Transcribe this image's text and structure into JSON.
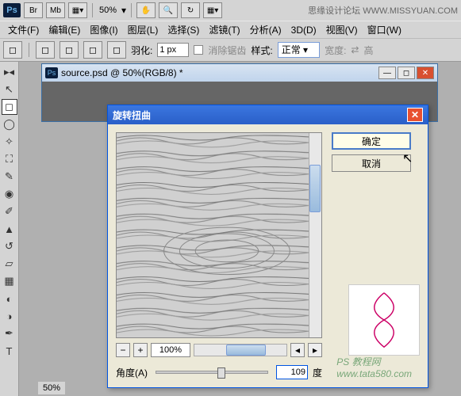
{
  "app": {
    "zoom": "50%",
    "watermark": "思缘设计论坛  WWW.MISSYUAN.COM"
  },
  "menu": {
    "file": "文件(F)",
    "edit": "编辑(E)",
    "image": "图像(I)",
    "layer": "图层(L)",
    "select": "选择(S)",
    "filter": "滤镜(T)",
    "analysis": "分析(A)",
    "threed": "3D(D)",
    "view": "视图(V)",
    "window": "窗口(W)"
  },
  "options": {
    "feather_label": "羽化:",
    "feather_value": "1 px",
    "antialias": "消除锯齿",
    "style_label": "样式:",
    "style_value": "正常",
    "width_label": "宽度:",
    "height_label": "高"
  },
  "document": {
    "title": "source.psd @ 50%(RGB/8) *",
    "status_zoom": "50%"
  },
  "dialog": {
    "title": "旋转扭曲",
    "ok": "确定",
    "cancel": "取消",
    "zoom_value": "100%",
    "angle_label": "角度(A)",
    "angle_value": "109",
    "angle_unit": "度"
  },
  "watermarks": {
    "site": "www.tata580.com",
    "label": "PS 教程网"
  }
}
